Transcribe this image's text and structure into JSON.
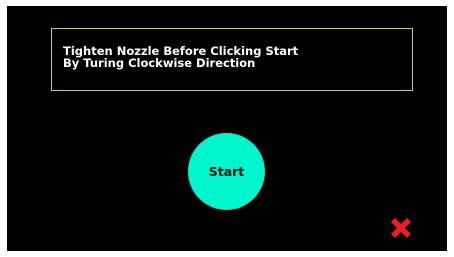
{
  "instruction": {
    "line1": "Tighten Nozzle Before Clicking Start",
    "line2": "By Turing Clockwise Direction"
  },
  "start_button": {
    "label": "Start"
  },
  "close_button": {
    "icon": "close-icon",
    "color": "#ee1c25"
  },
  "colors": {
    "background": "#000000",
    "box_border": "#b5d66b",
    "start_button": "#00f5cc",
    "text": "#ffffff"
  }
}
